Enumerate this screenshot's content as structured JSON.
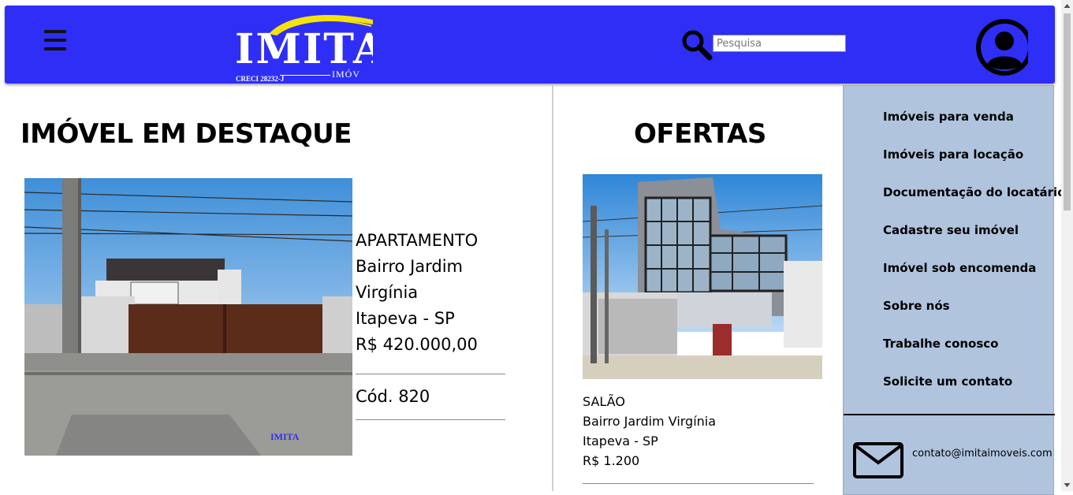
{
  "header": {
    "logo_text": "IMITA",
    "logo_creci": "CRECI 28232-J",
    "logo_subtext": "IMÓV",
    "search_placeholder": "Pesquisa",
    "icons": {
      "menu": "hamburger-icon",
      "search": "search-icon",
      "user": "user-avatar-icon"
    },
    "colors": {
      "bar": "#2f2ef6",
      "logo_swoosh": "#f5e20c"
    }
  },
  "featured": {
    "title": "IMÓVEL EM DESTAQUE",
    "type": "APARTAMENTO",
    "neighborhood_line1": "Bairro Jardim",
    "neighborhood_line2": "Virgínia",
    "city": "Itapeva - SP",
    "price": "R$ 420.000,00",
    "code": "Cód. 820",
    "photo_watermark": "IMITA"
  },
  "offers": {
    "title": "OFERTAS",
    "items": [
      {
        "type": "SALÃO",
        "neighborhood": "Bairro Jardim Virgínia",
        "city": "Itapeva - SP",
        "price": "R$ 1.200"
      }
    ]
  },
  "side_menu": {
    "items": [
      {
        "label": "Imóveis para venda"
      },
      {
        "label": "Imóveis para locação"
      },
      {
        "label": "Documentação do locatário"
      },
      {
        "label": "Cadastre seu imóvel"
      },
      {
        "label": "Imóvel sob encomenda"
      },
      {
        "label": "Sobre nós"
      },
      {
        "label": "Trabalhe conosco"
      },
      {
        "label": "Solicite um contato"
      }
    ],
    "email": "contato@imitaimoveis.com",
    "email_icon": "envelope-icon",
    "background": "#b0c4de"
  }
}
